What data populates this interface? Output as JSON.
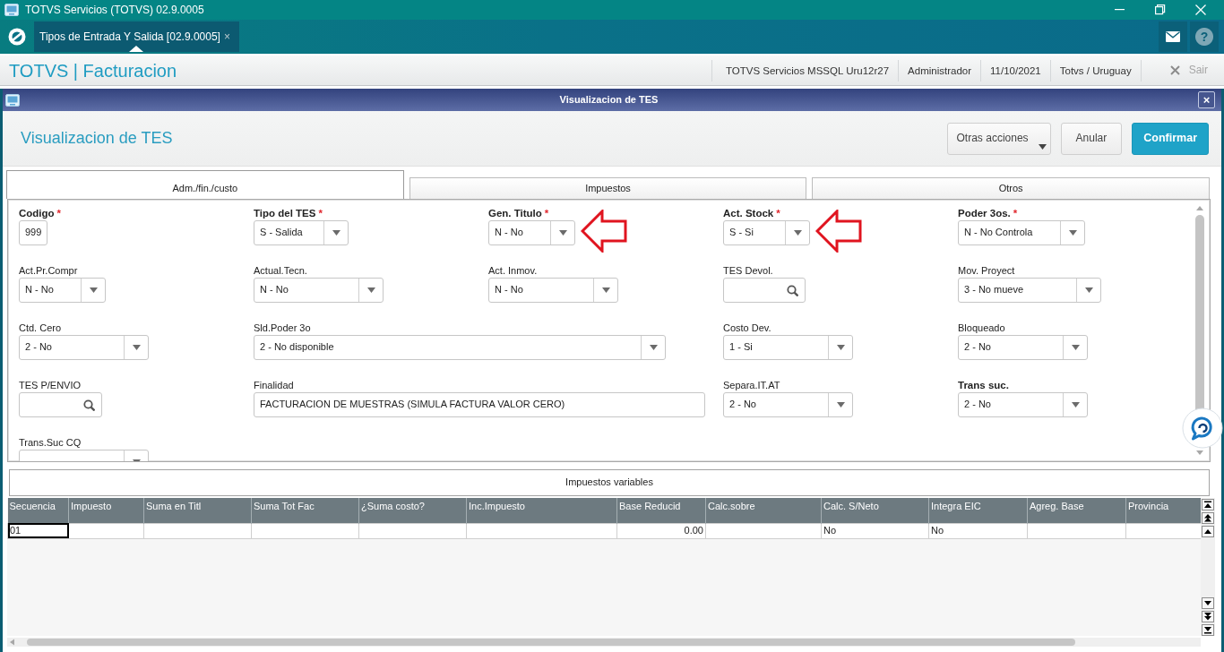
{
  "window": {
    "title": "TOTVS Servicios (TOTVS) 02.9.0005"
  },
  "app_tabs": [
    {
      "label": "Tipos de Entrada Y Salida [02.9.0005]",
      "close": "×",
      "selected": true
    }
  ],
  "toolbar": {
    "help": "?"
  },
  "header": {
    "title": "TOTVS | Facturacion",
    "info": [
      "TOTVS Servicios MSSQL Uru12r27",
      "Administrador",
      "11/10/2021",
      "Totvs / Uruguay"
    ],
    "exit": {
      "label": "Sair",
      "disabled": true
    }
  },
  "dialog": {
    "title": "Visualizacion de TES",
    "close": "×",
    "heading": "Visualizacion de TES",
    "buttons": [
      {
        "label": "Otras acciones",
        "kind": "menu"
      },
      {
        "label": "Anular",
        "kind": "default"
      },
      {
        "label": "Confirmar",
        "kind": "primary"
      }
    ],
    "tabs": [
      {
        "label": "Adm./fin./custo",
        "selected": true
      },
      {
        "label": "Impuestos",
        "selected": false
      },
      {
        "label": "Otros",
        "selected": false
      }
    ],
    "fields": [
      {
        "label": "Codigo",
        "required": true,
        "required_mark": "*",
        "kind": "text",
        "value": "999",
        "pointed_by_arrow": false
      },
      {
        "label": "Tipo del TES",
        "required": true,
        "required_mark": "*",
        "kind": "select",
        "value": "S - Salida",
        "pointed_by_arrow": false
      },
      {
        "label": "Gen. Titulo",
        "required": true,
        "required_mark": "*",
        "kind": "select",
        "value": "N - No",
        "pointed_by_arrow": true
      },
      {
        "label": "Act. Stock",
        "required": true,
        "required_mark": "*",
        "kind": "select",
        "value": "S - Si",
        "pointed_by_arrow": true
      },
      {
        "label": "Poder 3os.",
        "required": true,
        "required_mark": "*",
        "kind": "select",
        "value": "N - No Controla",
        "pointed_by_arrow": false
      },
      {
        "label": "Act.Pr.Compr",
        "required": false,
        "kind": "select",
        "value": "N - No",
        "pointed_by_arrow": false
      },
      {
        "label": "Actual.Tecn.",
        "required": false,
        "kind": "select",
        "value": "N - No",
        "pointed_by_arrow": false
      },
      {
        "label": "Act. Inmov.",
        "required": false,
        "kind": "select",
        "value": "N - No",
        "pointed_by_arrow": false
      },
      {
        "label": "TES Devol.",
        "required": false,
        "kind": "search",
        "pointed_by_arrow": false
      },
      {
        "label": "Mov. Proyect",
        "required": false,
        "kind": "select",
        "value": "3 - No mueve",
        "pointed_by_arrow": false
      },
      {
        "label": "Ctd. Cero",
        "required": false,
        "kind": "select",
        "value": "2 - No",
        "pointed_by_arrow": false
      },
      {
        "label": "Sld.Poder 3o",
        "required": false,
        "kind": "select",
        "value": "2 - No disponible",
        "pointed_by_arrow": false
      },
      {
        "label": "Costo Dev.",
        "required": false,
        "kind": "select",
        "value": "1 - Si",
        "pointed_by_arrow": false
      },
      {
        "label": "Bloqueado",
        "required": false,
        "kind": "select",
        "value": "2 - No",
        "pointed_by_arrow": false
      },
      {
        "label": "TES P/ENVIO",
        "required": false,
        "kind": "search",
        "pointed_by_arrow": false
      },
      {
        "label": "Finalidad",
        "required": false,
        "kind": "text",
        "value": "FACTURACION DE MUESTRAS (SIMULA FACTURA VALOR CERO)",
        "pointed_by_arrow": false
      },
      {
        "label": "Separa.IT.AT",
        "required": false,
        "kind": "select",
        "value": "2 - No",
        "pointed_by_arrow": false
      },
      {
        "label": "Trans suc.",
        "required": true,
        "kind": "select",
        "value": "2 - No",
        "pointed_by_arrow": false
      },
      {
        "label": "Trans.Suc CQ",
        "required": false,
        "kind": "select",
        "pointed_by_arrow": false
      }
    ],
    "grid": {
      "title": "Impuestos variables",
      "columns": [
        {
          "label": "Secuencia",
          "kind": "text"
        },
        {
          "label": "Impuesto",
          "kind": "text"
        },
        {
          "label": "Suma en Titl",
          "kind": "text"
        },
        {
          "label": "Suma Tot Fac",
          "kind": "text"
        },
        {
          "label": "¿Suma costo?",
          "kind": "text"
        },
        {
          "label": "Inc.Impuesto",
          "kind": "text"
        },
        {
          "label": "Base Reducid",
          "kind": "number"
        },
        {
          "label": "Calc.sobre",
          "kind": "text"
        },
        {
          "label": "Calc. S/Neto",
          "kind": "text"
        },
        {
          "label": "Integra EIC",
          "kind": "text"
        },
        {
          "label": "Agreg. Base",
          "kind": "text"
        },
        {
          "label": "Provincia",
          "kind": "text"
        }
      ],
      "rows": [
        {
          "selected": true,
          "cells": [
            "01",
            null,
            null,
            null,
            null,
            null,
            "0.00",
            null,
            "No",
            "No",
            null,
            null
          ]
        }
      ]
    }
  }
}
